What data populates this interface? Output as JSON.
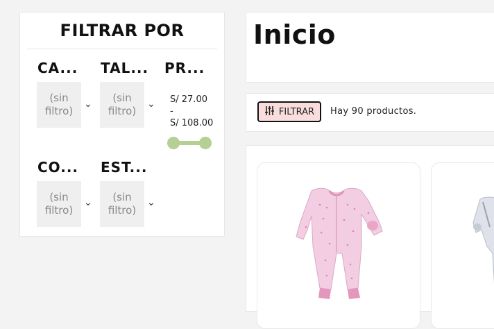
{
  "filters": {
    "title": "FILTRAR POR",
    "facets": [
      {
        "label": "CA...",
        "value": "(sin filtro)"
      },
      {
        "label": "TAL...",
        "value": "(sin filtro)"
      },
      {
        "label": "PR..."
      },
      {
        "label": "CO...",
        "value": "(sin filtro)"
      },
      {
        "label": "EST...",
        "value": "(sin filtro)"
      }
    ],
    "price": {
      "min": "S/ 27.00",
      "separator": "-",
      "max": "S/ 108.00"
    },
    "price_range_fraction": [
      0,
      1
    ]
  },
  "header": {
    "title": "Inicio"
  },
  "toolbar": {
    "filter_label": "FILTRAR",
    "count_text": "Hay 90 productos."
  },
  "colors": {
    "accent_pink": "#f9dcdc",
    "slider_green": "#b5cf94",
    "select_gray": "#efefef"
  },
  "icons": {
    "filter": "sliders-icon",
    "dropdown": "chevron-down-icon"
  }
}
